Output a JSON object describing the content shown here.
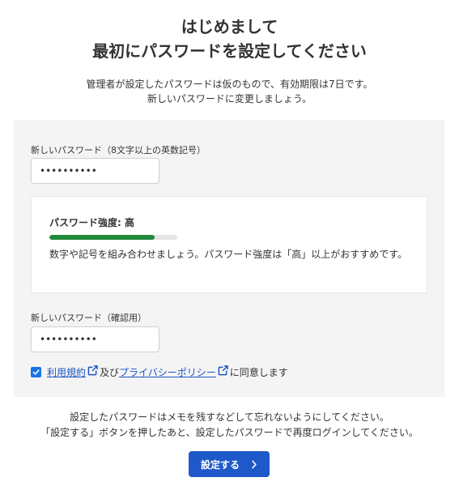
{
  "header": {
    "title_line1": "はじめまして",
    "title_line2": "最初にパスワードを設定してください"
  },
  "intro": {
    "line1": "管理者が設定したパスワードは仮のもので、有効期限は7日です。",
    "line2": "新しいパスワードに変更しましょう。"
  },
  "form": {
    "new_password": {
      "label": "新しいパスワード（8文字以上の英数記号）",
      "value": "••••••••••"
    },
    "strength": {
      "title": "パスワード強度: 高",
      "level_percent": 82,
      "bar_color": "#1f8a3b",
      "hint": "数字や記号を組み合わせましょう。パスワード強度は「高」以上がおすすめです。"
    },
    "confirm_password": {
      "label": "新しいパスワード（確認用）",
      "value": "••••••••••"
    },
    "agreement": {
      "checked": true,
      "terms_link": "利用規約",
      "connector": "及び",
      "privacy_link": "プライバシーポリシー",
      "suffix": "に同意します",
      "icon": "external-link-icon"
    }
  },
  "note": {
    "line1": "設定したパスワードはメモを残すなどして忘れないようにしてください。",
    "line2": "「設定する」ボタンを押したあと、設定したパスワードで再度ログインしてください。"
  },
  "submit": {
    "label": "設定する",
    "icon": "chevron-right-icon"
  },
  "colors": {
    "accent": "#1f59c9",
    "link": "#1a57c5",
    "panel_bg": "#f5f4f4",
    "strength_green": "#1f8a3b"
  }
}
